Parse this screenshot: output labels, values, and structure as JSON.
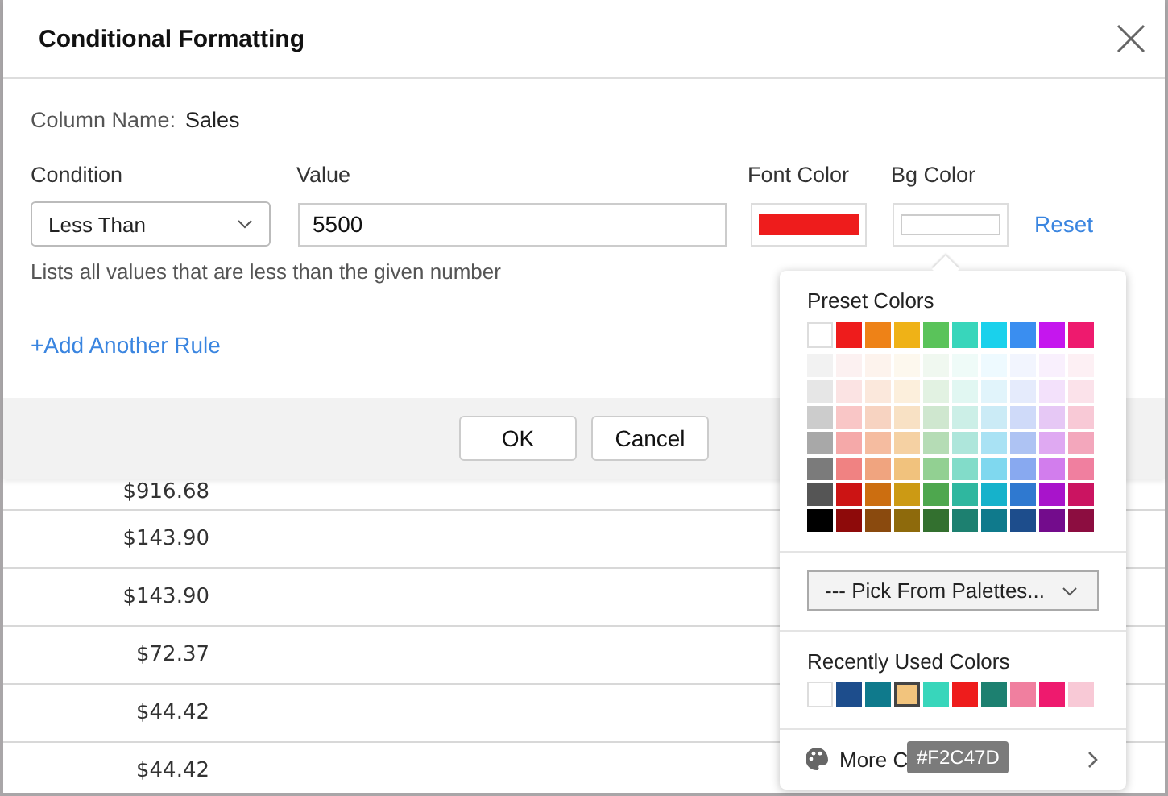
{
  "dialog": {
    "title": "Conditional Formatting",
    "column_label": "Column Name:",
    "column_value": "Sales",
    "headers": [
      "Condition",
      "Value",
      "Font Color",
      "Bg Color"
    ],
    "condition": "Less Than",
    "value": "5500",
    "font_color": {
      "color": "#ee1c1c"
    },
    "bg_color": {
      "color": "#ffffff"
    },
    "reset": "Reset",
    "hint": "Lists all values that are less than the given number",
    "add_rule": "+Add Another Rule",
    "buttons": [
      "OK",
      "Cancel"
    ]
  },
  "table": {
    "rows": [
      "$916.68",
      "$143.90",
      "$143.90",
      "$72.37",
      "$44.42",
      "$44.42"
    ]
  },
  "color_picker": {
    "preset_title": "Preset Colors",
    "preset": [
      {
        "swatches": [
          {
            "color": "#ffffff"
          },
          {
            "color": "#ee1c1c"
          },
          {
            "color": "#ee8217"
          },
          {
            "color": "#efb217"
          },
          {
            "color": "#5ac35a"
          },
          {
            "color": "#38d6bb"
          },
          {
            "color": "#1ad1ec"
          },
          {
            "color": "#3a8ef0"
          },
          {
            "color": "#c516ee"
          },
          {
            "color": "#ee1a6e"
          }
        ]
      },
      {
        "swatches": [
          {
            "color": "#f2f2f2"
          },
          {
            "color": "#fcf1f1"
          },
          {
            "color": "#fdf3ed"
          },
          {
            "color": "#fdf8ee"
          },
          {
            "color": "#f0f8f0"
          },
          {
            "color": "#effbf8"
          },
          {
            "color": "#eefaff"
          },
          {
            "color": "#f2f5fe"
          },
          {
            "color": "#f9f0fd"
          },
          {
            "color": "#fdf0f4"
          }
        ]
      },
      {
        "swatches": [
          {
            "color": "#e6e6e6"
          },
          {
            "color": "#fbe3e3"
          },
          {
            "color": "#fbe8dc"
          },
          {
            "color": "#fcefdc"
          },
          {
            "color": "#e2f2e2"
          },
          {
            "color": "#e1f7f2"
          },
          {
            "color": "#e1f4fb"
          },
          {
            "color": "#e5ebfc"
          },
          {
            "color": "#f3e1fb"
          },
          {
            "color": "#fbe2ea"
          }
        ]
      },
      {
        "swatches": [
          {
            "color": "#cccccc"
          },
          {
            "color": "#f9c6c6"
          },
          {
            "color": "#f7d3c1"
          },
          {
            "color": "#f8e1c4"
          },
          {
            "color": "#cfe7cf"
          },
          {
            "color": "#ccefe7"
          },
          {
            "color": "#cbebf6"
          },
          {
            "color": "#cfdaf9"
          },
          {
            "color": "#e6c8f5"
          },
          {
            "color": "#f8c9d6"
          }
        ]
      },
      {
        "swatches": [
          {
            "color": "#a8a8a8"
          },
          {
            "color": "#f5a9a9"
          },
          {
            "color": "#f5bca0"
          },
          {
            "color": "#f5d1a3"
          },
          {
            "color": "#b5dcb5"
          },
          {
            "color": "#aee6db"
          },
          {
            "color": "#a9e2f4"
          },
          {
            "color": "#aec3f3"
          },
          {
            "color": "#dfa9f2"
          },
          {
            "color": "#f3a7bc"
          }
        ]
      },
      {
        "swatches": [
          {
            "color": "#7b7b7b"
          },
          {
            "color": "#f08282"
          },
          {
            "color": "#f0a47f"
          },
          {
            "color": "#f1c27d"
          },
          {
            "color": "#92d092"
          },
          {
            "color": "#82dcc9"
          },
          {
            "color": "#7fd8ef"
          },
          {
            "color": "#88a9f0"
          },
          {
            "color": "#d27ded"
          },
          {
            "color": "#f07f9f"
          }
        ]
      },
      {
        "swatches": [
          {
            "color": "#555555"
          },
          {
            "color": "#cc1414"
          },
          {
            "color": "#cc6e10"
          },
          {
            "color": "#cc9a14"
          },
          {
            "color": "#4ea74e"
          },
          {
            "color": "#2fb79f"
          },
          {
            "color": "#16b2cb"
          },
          {
            "color": "#2f79d0"
          },
          {
            "color": "#a814cb"
          },
          {
            "color": "#cb1461"
          }
        ]
      },
      {
        "swatches": [
          {
            "color": "#000000"
          },
          {
            "color": "#8e0a0a"
          },
          {
            "color": "#8a4a0e"
          },
          {
            "color": "#8e6a0c"
          },
          {
            "color": "#33702f"
          },
          {
            "color": "#1d8070"
          },
          {
            "color": "#0f7a8c"
          },
          {
            "color": "#1d4d8c"
          },
          {
            "color": "#730c8c"
          },
          {
            "color": "#8c0d40"
          }
        ]
      }
    ],
    "palette_select": "--- Pick From Palettes...",
    "recent_title": "Recently Used Colors",
    "recent": [
      {
        "color": "#ffffff",
        "selected": false
      },
      {
        "color": "#1d4d8c",
        "selected": false
      },
      {
        "color": "#0f7a8c",
        "selected": false
      },
      {
        "color": "#f2c47d",
        "selected": true
      },
      {
        "color": "#38d6bb",
        "selected": false
      },
      {
        "color": "#ee1c1c",
        "selected": false
      },
      {
        "color": "#1d8070",
        "selected": false
      },
      {
        "color": "#f07f9f",
        "selected": false
      },
      {
        "color": "#ee1a6e",
        "selected": false
      },
      {
        "color": "#f8c9d6",
        "selected": false
      }
    ],
    "more": "More C",
    "tooltip": "#F2C47D"
  }
}
